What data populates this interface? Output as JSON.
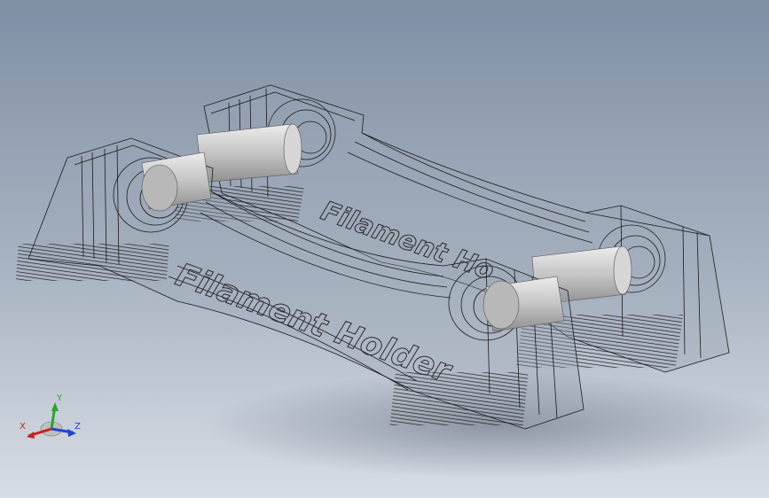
{
  "scene": {
    "front_label": "Filament Holder",
    "rear_label": "Filament Ho"
  },
  "triad": {
    "x_label": "X",
    "y_label": "Y",
    "z_label": "Z",
    "x_color": "#cc1f1f",
    "y_color": "#2aa52a",
    "z_color": "#2244cc"
  },
  "colors": {
    "wireframe": "#1a1a1a",
    "rod": "#c9c9c9"
  }
}
